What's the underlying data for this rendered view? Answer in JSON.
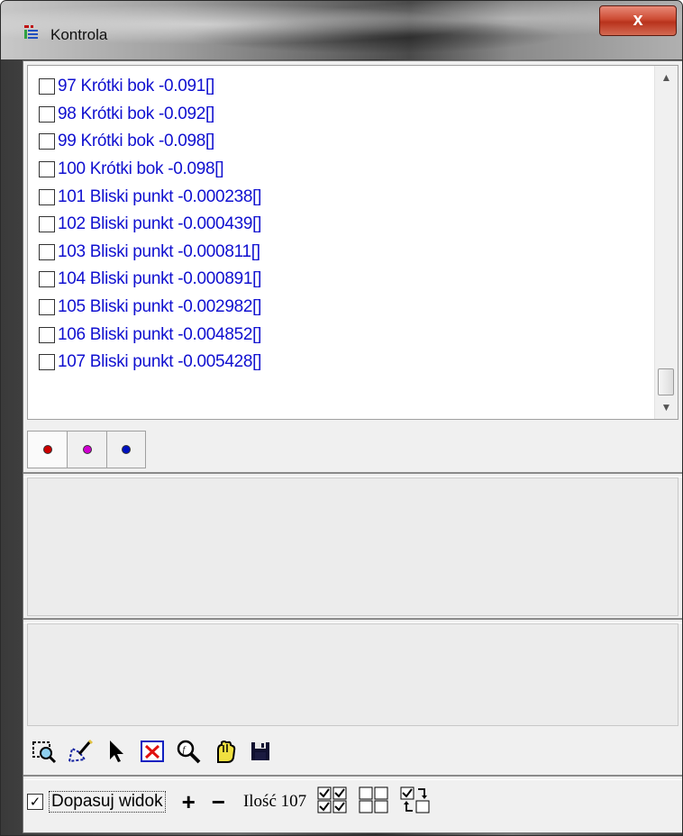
{
  "window": {
    "title": "Kontrola",
    "close_label": "x"
  },
  "list": {
    "items": [
      {
        "label": "97  Krótki bok -0.091[]",
        "checked": false
      },
      {
        "label": "98  Krótki bok -0.092[]",
        "checked": false
      },
      {
        "label": "99  Krótki bok -0.098[]",
        "checked": false
      },
      {
        "label": "100  Krótki bok -0.098[]",
        "checked": false
      },
      {
        "label": "101  Bliski punkt -0.000238[]",
        "checked": false
      },
      {
        "label": "102  Bliski punkt -0.000439[]",
        "checked": false
      },
      {
        "label": "103  Bliski punkt -0.000811[]",
        "checked": false
      },
      {
        "label": "104  Bliski punkt -0.000891[]",
        "checked": false
      },
      {
        "label": "105  Bliski punkt -0.002982[]",
        "checked": false
      },
      {
        "label": "106  Bliski punkt -0.004852[]",
        "checked": false
      },
      {
        "label": "107  Bliski punkt -0.005428[]",
        "checked": false
      }
    ],
    "item_color": "#1010d0"
  },
  "tabs": [
    {
      "icon": "red-dot-icon",
      "color": "#cc0000"
    },
    {
      "icon": "magenta-dot-icon",
      "color": "#d000d0"
    },
    {
      "icon": "blue-dot-icon",
      "color": "#0010c0"
    }
  ],
  "toolbar": {
    "icons": [
      "select-area-icon",
      "edit-polygon-icon",
      "pointer-icon",
      "delete-icon",
      "zoom-icon",
      "hand-icon",
      "save-icon"
    ]
  },
  "status": {
    "fit_view_label": "Dopasuj widok",
    "fit_view_checked": true,
    "plus_label": "+",
    "minus_label": "−",
    "count_label": "Ilość 107"
  }
}
